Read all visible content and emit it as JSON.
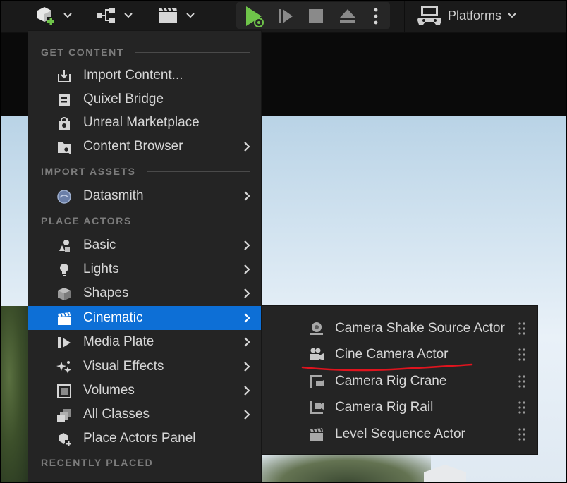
{
  "toolbar": {
    "platforms_label": "Platforms",
    "icons": [
      "add-content-icon",
      "blueprint-icon",
      "cinematics-icon",
      "play-icon",
      "advance-frame-icon",
      "stop-icon",
      "eject-icon",
      "more-icon",
      "platforms-icon"
    ],
    "accent_green": "#6fc44a"
  },
  "menu": {
    "sections": {
      "get_content": "GET CONTENT",
      "import_assets": "IMPORT ASSETS",
      "place_actors": "PLACE ACTORS",
      "recently_placed": "RECENTLY PLACED"
    },
    "items": {
      "import_content": "Import Content...",
      "quixel_bridge": "Quixel Bridge",
      "unreal_marketplace": "Unreal Marketplace",
      "content_browser": "Content Browser",
      "datasmith": "Datasmith",
      "basic": "Basic",
      "lights": "Lights",
      "shapes": "Shapes",
      "cinematic": "Cinematic",
      "media_plate": "Media Plate",
      "visual_effects": "Visual Effects",
      "volumes": "Volumes",
      "all_classes": "All Classes",
      "place_actors_panel": "Place Actors Panel"
    },
    "highlight_color": "#0d6fd6"
  },
  "submenu": {
    "items": [
      "Camera Shake Source Actor",
      "Cine Camera Actor",
      "Camera Rig Crane",
      "Camera Rig Rail",
      "Level Sequence Actor"
    ]
  },
  "annotation_color": "#e0141e"
}
